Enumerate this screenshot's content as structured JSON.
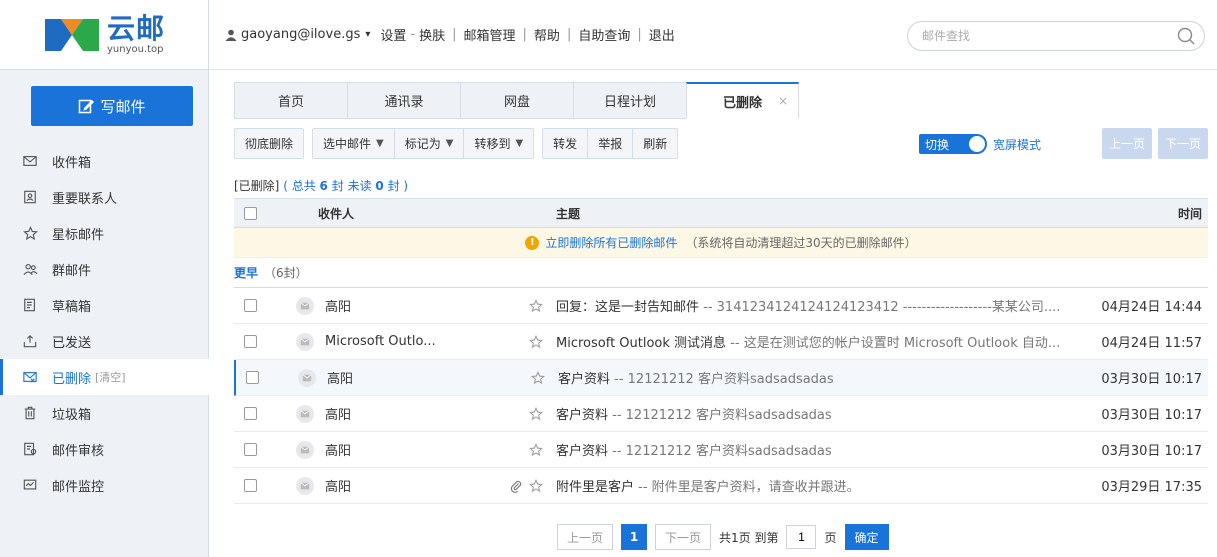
{
  "brand": {
    "name_cn": "云邮",
    "name_en": "yunyou.top"
  },
  "sidebar": {
    "compose_label": "写邮件",
    "items": [
      {
        "label": "收件箱",
        "icon": "inbox-icon"
      },
      {
        "label": "重要联系人",
        "icon": "contact-icon"
      },
      {
        "label": "星标邮件",
        "icon": "star-icon"
      },
      {
        "label": "群邮件",
        "icon": "group-icon"
      },
      {
        "label": "草稿箱",
        "icon": "draft-icon"
      },
      {
        "label": "已发送",
        "icon": "sent-icon"
      },
      {
        "label": "已删除",
        "icon": "deleted-icon",
        "extra": "[清空]"
      },
      {
        "label": "垃圾箱",
        "icon": "trash-icon"
      },
      {
        "label": "邮件审核",
        "icon": "audit-icon"
      },
      {
        "label": "邮件监控",
        "icon": "monitor-icon"
      }
    ]
  },
  "topbar": {
    "user": "gaoyang@ilove.gs",
    "dropdown": "▾",
    "links": [
      "设置",
      "换肤",
      "邮箱管理",
      "帮助",
      "自助查询",
      "退出"
    ],
    "settings_dash": "-",
    "search_placeholder": "邮件查找"
  },
  "tabs": [
    {
      "label": "首页"
    },
    {
      "label": "通讯录"
    },
    {
      "label": "网盘"
    },
    {
      "label": "日程计划"
    },
    {
      "label": "已删除",
      "close": "×"
    }
  ],
  "toolbar": {
    "delete_forever": "彻底删除",
    "select_mail": "选中邮件",
    "mark_as": "标记为",
    "move_to": "转移到",
    "caret": "▼",
    "forward": "转发",
    "report": "举报",
    "refresh": "刷新",
    "toggle_label": "切换",
    "toggle_text": "宽屏模式",
    "prev": "上一页",
    "next": "下一页"
  },
  "info": {
    "prefix": "[已删除]",
    "open": "( 总共",
    "total": "6",
    "unit1": "封",
    "unread_label": "未读",
    "unread": "0",
    "unit2": "封 )"
  },
  "table": {
    "headers": {
      "recipient": "收件人",
      "subject": "主题",
      "time": "时间"
    },
    "notice": {
      "link": "立即删除所有已删除邮件",
      "note": "（系统将自动清理超过30天的已删除邮件）"
    },
    "group": {
      "label": "更早",
      "count": "（6封）"
    },
    "rows": [
      {
        "sender": "高阳",
        "subject": "回复：这是一封告知邮件",
        "summary": " -- 3141234124124124123412 -------------------某某公司....",
        "time": "04月24日 14:44",
        "attach": false
      },
      {
        "sender": "Microsoft Outlo...",
        "subject": "Microsoft Outlook 测试消息",
        "summary": " -- 这是在测试您的帐户设置时 Microsoft Outlook 自动...",
        "time": "04月24日 11:57",
        "attach": false
      },
      {
        "sender": "高阳",
        "subject": "客户资料",
        "summary": " -- 12121212  客户资料sadsadsadas",
        "time": "03月30日 10:17",
        "attach": false
      },
      {
        "sender": "高阳",
        "subject": "客户资料",
        "summary": " -- 12121212 客户资料sadsadsadas",
        "time": "03月30日 10:17",
        "attach": false
      },
      {
        "sender": "高阳",
        "subject": "客户资料",
        "summary": " -- 12121212 客户资料sadsadsadas",
        "time": "03月30日 10:17",
        "attach": false
      },
      {
        "sender": "高阳",
        "subject": "附件里是客户",
        "summary": " -- 附件里是客户资料，请查收并跟进。",
        "time": "03月29日 17:35",
        "attach": true
      }
    ]
  },
  "pager": {
    "prev": "上一页",
    "current": "1",
    "next": "下一页",
    "total_text": "共1页 到第",
    "page_value": "1",
    "page_unit": "页",
    "confirm": "确定"
  },
  "colors": {
    "accent": "#1a73d9",
    "sidebar_bg": "#eef2f7",
    "notice_bg": "#fdf8e6"
  }
}
